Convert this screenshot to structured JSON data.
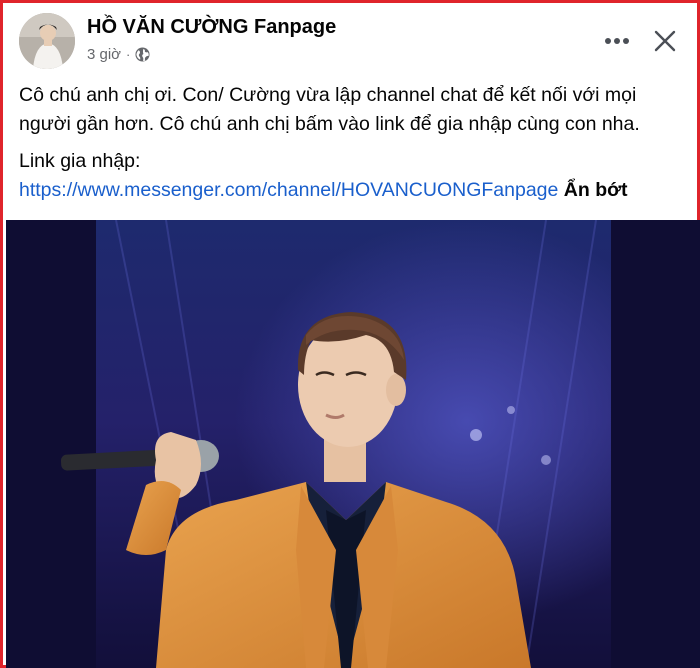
{
  "post": {
    "author": "HỒ VĂN CƯỜNG Fanpage",
    "time": "3 giờ",
    "separator": "·",
    "privacy_icon": "globe-icon",
    "more_icon": "more-horizontal-icon",
    "close_icon": "close-icon",
    "body_line": "Cô chú anh chị ơi. Con/ Cường vừa lập channel chat để kết nối với mọi người gần hơn. Cô chú anh chị bấm vào link để gia nhập cùng con nha.",
    "link_label": "Link gia nhập:",
    "link_url": "https://www.messenger.com/channel/HOVANCUONGFanpage",
    "collapse_label": "Ẩn bớt"
  },
  "colors": {
    "frame": "#e0242b",
    "link": "#1a5fcc",
    "meta": "#65676b"
  }
}
